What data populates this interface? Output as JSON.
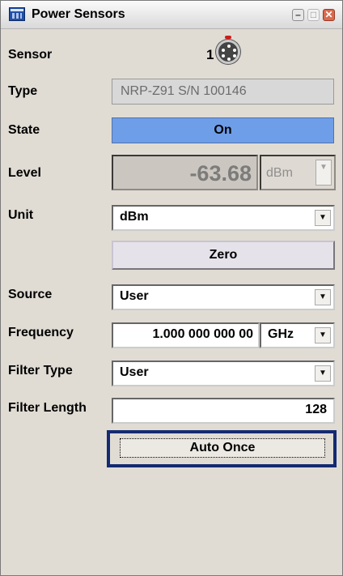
{
  "window": {
    "title": "Power Sensors",
    "controls": {
      "minimize": "–",
      "maximize": "□",
      "close": "✕"
    }
  },
  "sensor": {
    "label": "Sensor",
    "value": "1",
    "icon": "sensor-connector-icon"
  },
  "type": {
    "label": "Type",
    "value": "NRP-Z91 S/N 100146"
  },
  "state": {
    "label": "State",
    "value": "On",
    "color": "#6f9ee8"
  },
  "level": {
    "label": "Level",
    "value": "-63.68",
    "unit": "dBm"
  },
  "unit": {
    "label": "Unit",
    "value": "dBm"
  },
  "zero": {
    "label": "Zero"
  },
  "source": {
    "label": "Source",
    "value": "User"
  },
  "frequency": {
    "label": "Frequency",
    "value": "1.000 000 000 00",
    "unit": "GHz"
  },
  "filter_type": {
    "label": "Filter Type",
    "value": "User"
  },
  "filter_length": {
    "label": "Filter Length",
    "value": "128"
  },
  "auto_once": {
    "label": "Auto Once",
    "focus_color": "#142a72"
  },
  "glyphs": {
    "dropdown": "▼"
  }
}
